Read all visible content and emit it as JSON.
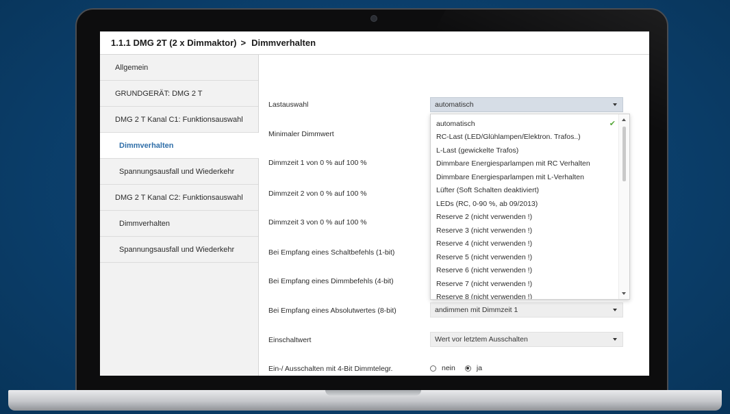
{
  "breadcrumb": {
    "device": "1.1.1 DMG 2T (2 x Dimmaktor)",
    "separator": ">",
    "page": "Dimmverhalten"
  },
  "sidebar": {
    "items": [
      {
        "label": "Allgemein",
        "active": false
      },
      {
        "label": "GRUNDGERÄT: DMG 2 T",
        "active": false
      },
      {
        "label": "DMG 2 T Kanal C1: Funktionsauswahl",
        "active": false
      },
      {
        "label": "Dimmverhalten",
        "active": true
      },
      {
        "label": "Spannungsausfall und Wiederkehr",
        "active": false
      },
      {
        "label": "DMG 2 T Kanal C2: Funktionsauswahl",
        "active": false
      },
      {
        "label": "Dimmverhalten",
        "active": false
      },
      {
        "label": "Spannungsausfall und Wiederkehr",
        "active": false
      }
    ]
  },
  "params": {
    "lastauswahl": {
      "label": "Lastauswahl",
      "value": "automatisch"
    },
    "min_dimmwert": {
      "label": "Minimaler Dimmwert"
    },
    "dimmzeit1": {
      "label": "Dimmzeit 1 von 0 % auf 100 %"
    },
    "dimmzeit2": {
      "label": "Dimmzeit 2 von 0 % auf 100 %"
    },
    "dimmzeit3": {
      "label": "Dimmzeit 3 von 0 % auf 100 %"
    },
    "schaltbefehl": {
      "label": "Bei Empfang eines Schaltbefehls (1-bit)"
    },
    "dimmbefehl": {
      "label": "Bei Empfang eines Dimmbefehls (4-bit)"
    },
    "absolutwert": {
      "label": "Bei Empfang eines Absolutwertes (8-bit)",
      "value": "andimmen mit Dimmzeit 1"
    },
    "einschaltwert": {
      "label": "Einschaltwert",
      "value": "Wert vor letztem Ausschalten"
    },
    "ein_aus_4bit": {
      "label": "Ein-/ Ausschalten mit 4-Bit Dimmtelegr.",
      "options": [
        "nein",
        "ja"
      ],
      "selected": "ja"
    }
  },
  "dropdown": {
    "selected": "automatisch",
    "options": [
      "automatisch",
      "RC-Last (LED/Glühlampen/Elektron. Trafos..)",
      "L-Last (gewickelte Trafos)",
      "Dimmbare Energiesparlampen mit RC Verhalten",
      "Dimmbare Energiesparlampen mit L-Verhalten",
      "Lüfter (Soft Schalten deaktiviert)",
      "LEDs (RC, 0-90 %, ab 09/2013)",
      "Reserve 2 (nicht verwenden !)",
      "Reserve 3 (nicht verwenden !)",
      "Reserve 4 (nicht verwenden !)",
      "Reserve 5 (nicht verwenden !)",
      "Reserve 6 (nicht verwenden !)",
      "Reserve 7 (nicht verwenden !)",
      "Reserve 8 (nicht verwenden !)"
    ]
  },
  "colors": {
    "background": "#0b3f6c",
    "active_link": "#2f6ea8",
    "check": "#57a83a"
  }
}
